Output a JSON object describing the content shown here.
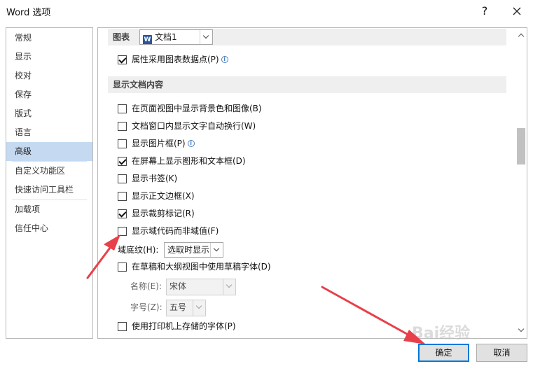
{
  "window": {
    "title": "Word 选项",
    "help_label": "?"
  },
  "sidebar": {
    "items": [
      {
        "label": "常规"
      },
      {
        "label": "显示"
      },
      {
        "label": "校对"
      },
      {
        "label": "保存"
      },
      {
        "label": "版式"
      },
      {
        "label": "语言"
      },
      {
        "label": "高级",
        "active": true
      },
      {
        "label": "自定义功能区"
      },
      {
        "label": "快速访问工具栏"
      },
      {
        "label": "加载项"
      },
      {
        "label": "信任中心"
      }
    ]
  },
  "content": {
    "chart_section": {
      "label": "图表",
      "document_dropdown": {
        "value": "文档1",
        "icon": "word-document-icon"
      }
    },
    "chart_options": [
      {
        "label": "属性采用图表数据点(P)",
        "checked": true,
        "info": true
      }
    ],
    "display_section": {
      "label": "显示文档内容"
    },
    "display_options": [
      {
        "label": "在页面视图中显示背景色和图像(B)",
        "checked": false
      },
      {
        "label": "文档窗口内显示文字自动换行(W)",
        "checked": false
      },
      {
        "label": "显示图片框(P)",
        "checked": false,
        "info": true
      },
      {
        "label": "在屏幕上显示图形和文本框(D)",
        "checked": true
      },
      {
        "label": "显示书签(K)",
        "checked": false
      },
      {
        "label": "显示正文边框(X)",
        "checked": false
      },
      {
        "label": "显示裁剪标记(R)",
        "checked": true
      },
      {
        "label": "显示域代码而非域值(F)",
        "checked": false
      }
    ],
    "field_shading": {
      "label": "域底纹(H):",
      "value": "选取时显示"
    },
    "draft_font_option": {
      "label": "在草稿和大纲视图中使用草稿字体(D)",
      "checked": false
    },
    "font_name": {
      "label": "名称(E):",
      "value": "宋体"
    },
    "font_size": {
      "label": "字号(Z):",
      "value": "五号"
    },
    "printer_fonts_option": {
      "label": "使用打印机上存储的字体(P)",
      "checked": false
    }
  },
  "buttons": {
    "ok_label": "确定",
    "cancel_label": "取消"
  },
  "annotations": {
    "arrow_color": "#e8404a"
  },
  "colors": {
    "selected_item": "#c5d9f1",
    "section_header": "#efefef",
    "primary_border": "#0078d7"
  },
  "watermark": {
    "text": "Bai经验"
  }
}
